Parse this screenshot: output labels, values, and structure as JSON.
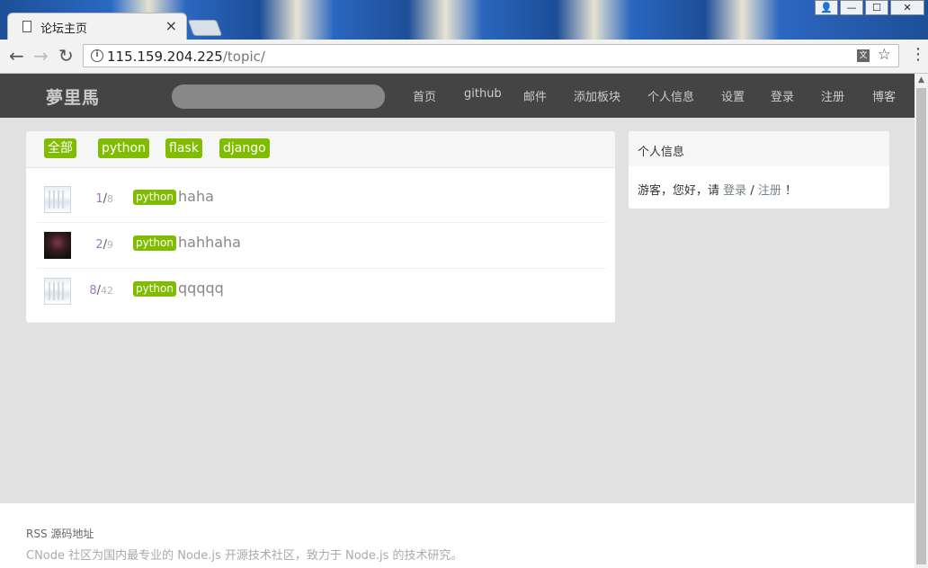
{
  "browser": {
    "tab_title": "论坛主页",
    "url_host": "115.159.204.225",
    "url_path": "/topic/"
  },
  "icons": {
    "tab_close": "×",
    "back": "←",
    "forward": "→",
    "reload": "↻",
    "info": "i",
    "translate": "文",
    "star": "☆",
    "menu": "⋮",
    "win_user": "👤",
    "win_min": "—",
    "win_max": "☐",
    "win_close": "✕",
    "scroll_up": "▲"
  },
  "navbar": {
    "brand": "夢里馬",
    "search_placeholder": "",
    "links": [
      "首页",
      "github",
      "邮件",
      "添加板块",
      "个人信息",
      "设置",
      "登录",
      "注册",
      "博客"
    ]
  },
  "board_tabs": [
    "全部",
    "python",
    "flask",
    "django"
  ],
  "topics": [
    {
      "reply": "1",
      "visit": "8",
      "tag": "python",
      "title": "haha",
      "avatar": "screenshot-avatar"
    },
    {
      "reply": "2",
      "visit": "9",
      "tag": "python",
      "title": "hahhaha",
      "avatar": "dark-photo-avatar"
    },
    {
      "reply": "8",
      "visit": "42",
      "tag": "python",
      "title": "qqqqq",
      "avatar": "screenshot-avatar"
    }
  ],
  "sidebar": {
    "title": "个人信息",
    "greeting": "游客，您好，请",
    "login": "登录",
    "slash": "/",
    "register": "注册",
    "exclaim": "！"
  },
  "footer": {
    "links": "RSS 源码地址",
    "description": "CNode 社区为国内最专业的 Node.js 开源技术社区，致力于 Node.js 的技术研究。"
  },
  "colors": {
    "accent": "#80bd01",
    "navbar": "#444444",
    "page_bg": "#e1e1e1"
  }
}
